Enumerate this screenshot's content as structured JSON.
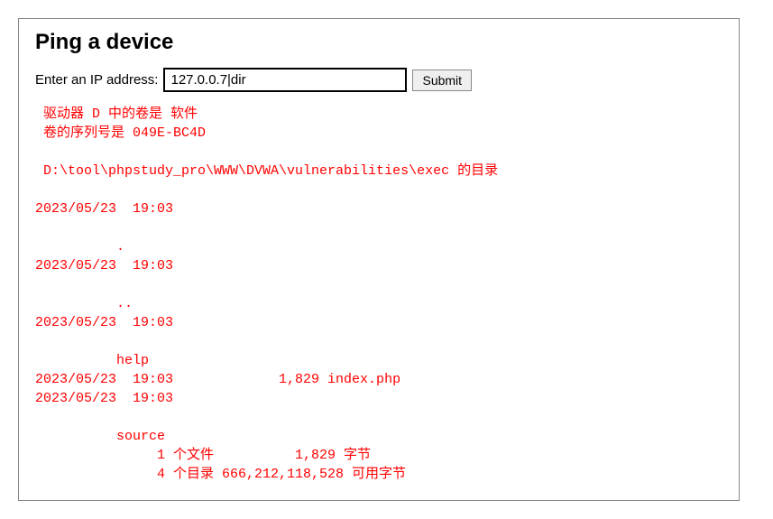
{
  "panel": {
    "title": "Ping a device",
    "label": "Enter an IP address:",
    "ip_value": "127.0.0.7|dir",
    "submit_label": "Submit"
  },
  "output_text": " 驱动器 D 中的卷是 软件\n 卷的序列号是 049E-BC4D\n\n D:\\tool\\phpstudy_pro\\WWW\\DVWA\\vulnerabilities\\exec 的目录\n\n2023/05/23  19:03    \n\n          .\n2023/05/23  19:03    \n\n          ..\n2023/05/23  19:03    \n\n          help\n2023/05/23  19:03             1,829 index.php\n2023/05/23  19:03    \n\n          source\n               1 个文件          1,829 字节\n               4 个目录 666,212,118,528 可用字节"
}
